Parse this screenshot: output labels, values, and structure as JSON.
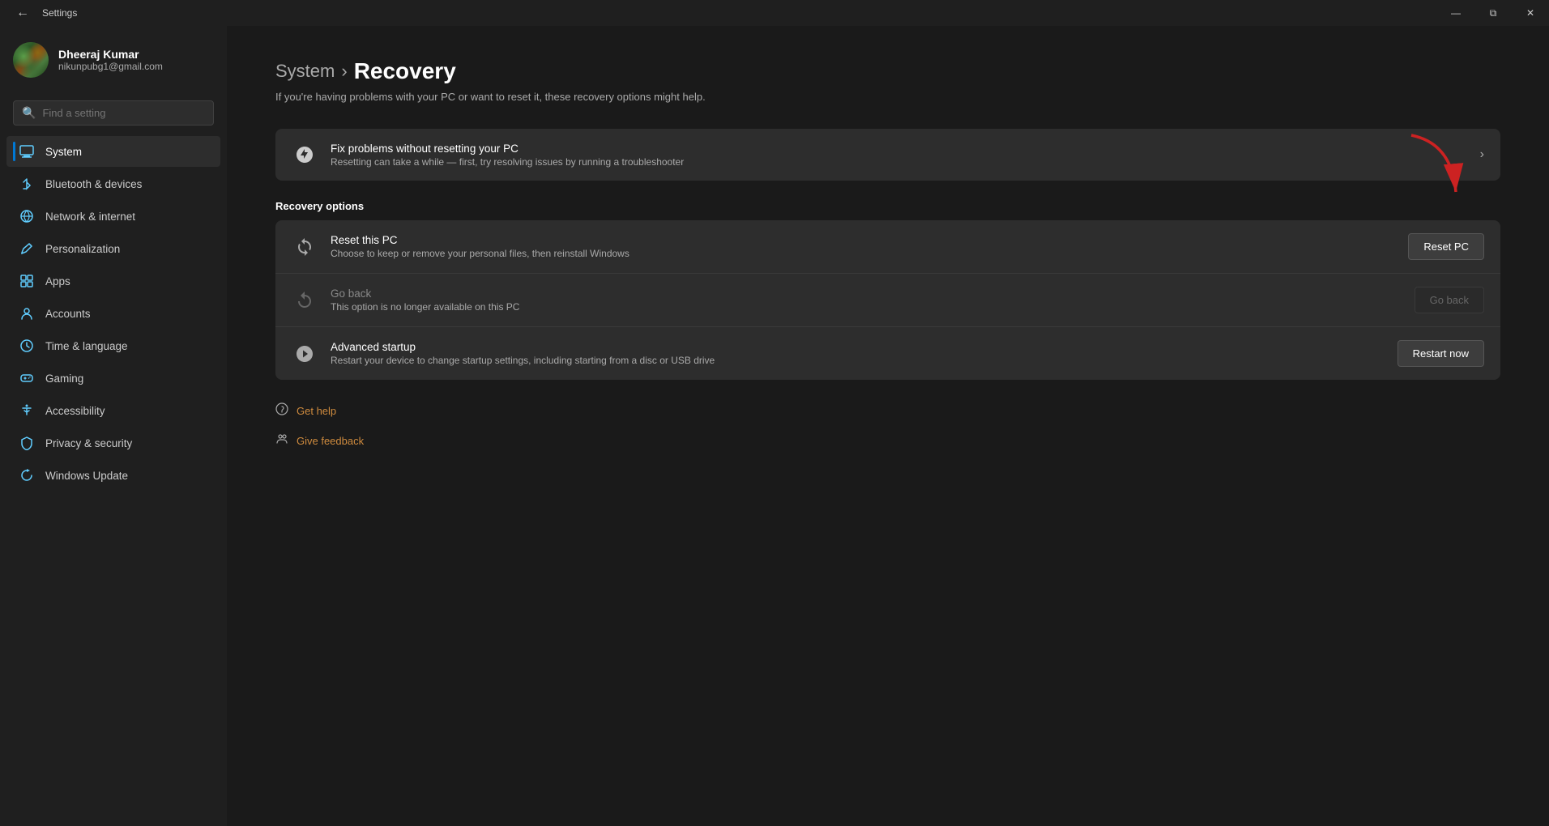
{
  "window": {
    "title": "Settings",
    "controls": {
      "minimize": "—",
      "maximize": "⧉",
      "close": "✕"
    }
  },
  "sidebar": {
    "user": {
      "name": "Dheeraj Kumar",
      "email": "nikunpubg1@gmail.com"
    },
    "search": {
      "placeholder": "Find a setting"
    },
    "nav": [
      {
        "id": "system",
        "label": "System",
        "icon": "🖥",
        "active": true
      },
      {
        "id": "bluetooth",
        "label": "Bluetooth & devices",
        "icon": "🔷",
        "active": false
      },
      {
        "id": "network",
        "label": "Network & internet",
        "icon": "🌐",
        "active": false
      },
      {
        "id": "personalization",
        "label": "Personalization",
        "icon": "✏️",
        "active": false
      },
      {
        "id": "apps",
        "label": "Apps",
        "icon": "📦",
        "active": false
      },
      {
        "id": "accounts",
        "label": "Accounts",
        "icon": "👤",
        "active": false
      },
      {
        "id": "time",
        "label": "Time & language",
        "icon": "🕐",
        "active": false
      },
      {
        "id": "gaming",
        "label": "Gaming",
        "icon": "🎮",
        "active": false
      },
      {
        "id": "accessibility",
        "label": "Accessibility",
        "icon": "♿",
        "active": false
      },
      {
        "id": "privacy",
        "label": "Privacy & security",
        "icon": "🔒",
        "active": false
      },
      {
        "id": "update",
        "label": "Windows Update",
        "icon": "🔄",
        "active": false
      }
    ]
  },
  "main": {
    "breadcrumb_parent": "System",
    "breadcrumb_separator": ">",
    "breadcrumb_current": "Recovery",
    "subtitle": "If you're having problems with your PC or want to reset it, these recovery options might help.",
    "fix_section": {
      "title": "Fix problems without resetting your PC",
      "description": "Resetting can take a while — first, try resolving issues by running a troubleshooter"
    },
    "recovery_options_label": "Recovery options",
    "recovery_options": [
      {
        "id": "reset",
        "title": "Reset this PC",
        "description": "Choose to keep or remove your personal files, then reinstall Windows",
        "action_label": "Reset PC",
        "disabled": false
      },
      {
        "id": "goback",
        "title": "Go back",
        "description": "This option is no longer available on this PC",
        "action_label": "Go back",
        "disabled": true
      },
      {
        "id": "advanced",
        "title": "Advanced startup",
        "description": "Restart your device to change startup settings, including starting from a disc or USB drive",
        "action_label": "Restart now",
        "disabled": false
      }
    ],
    "links": [
      {
        "id": "help",
        "label": "Get help",
        "icon": "❓"
      },
      {
        "id": "feedback",
        "label": "Give feedback",
        "icon": "👥"
      }
    ]
  }
}
